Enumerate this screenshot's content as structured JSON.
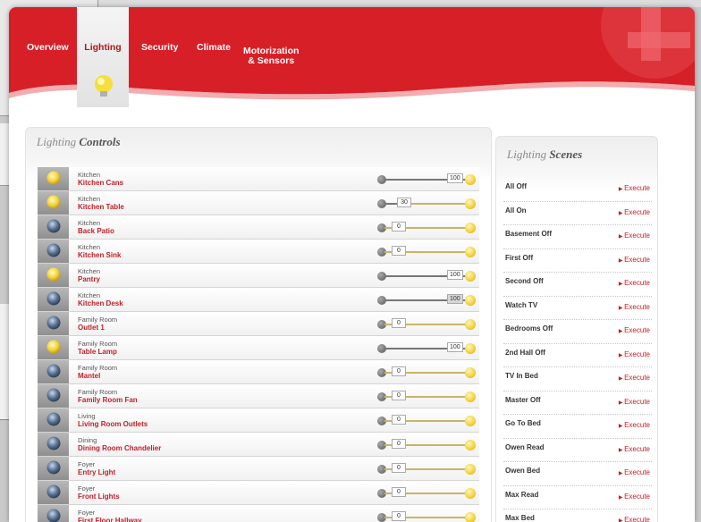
{
  "tabs": [
    {
      "label": "Overview"
    },
    {
      "label": "Lighting"
    },
    {
      "label": "Security"
    },
    {
      "label": "Climate"
    },
    {
      "label": "Motorization\n& Sensors"
    }
  ],
  "controls": {
    "title_a": "Lighting",
    "title_b": "Controls",
    "rows": [
      {
        "room": "Kitchen",
        "name": "Kitchen Cans",
        "value": "100",
        "level": 100,
        "on": true
      },
      {
        "room": "Kitchen",
        "name": "Kitchen Table",
        "value": "30",
        "level": 30,
        "on": true
      },
      {
        "room": "Kitchen",
        "name": "Back Patio",
        "value": "0",
        "level": 0,
        "on": false
      },
      {
        "room": "Kitchen",
        "name": "Kitchen Sink",
        "value": "0",
        "level": 0,
        "on": false
      },
      {
        "room": "Kitchen",
        "name": "Pantry",
        "value": "100",
        "level": 100,
        "on": true
      },
      {
        "room": "Kitchen",
        "name": "Kitchen Desk",
        "value": "100",
        "level": 100,
        "on": false
      },
      {
        "room": "Family Room",
        "name": "Outlet 1",
        "value": "0",
        "level": 0,
        "on": false
      },
      {
        "room": "Family Room",
        "name": "Table Lamp",
        "value": "100",
        "level": 100,
        "on": true
      },
      {
        "room": "Family Room",
        "name": "Mantel",
        "value": "0",
        "level": 0,
        "on": false
      },
      {
        "room": "Family Room",
        "name": "Family Room Fan",
        "value": "0",
        "level": 0,
        "on": false
      },
      {
        "room": "Living",
        "name": "Living Room Outlets",
        "value": "0",
        "level": 0,
        "on": false
      },
      {
        "room": "Dining",
        "name": "Dining Room Chandelier",
        "value": "0",
        "level": 0,
        "on": false
      },
      {
        "room": "Foyer",
        "name": "Entry Light",
        "value": "0",
        "level": 0,
        "on": false
      },
      {
        "room": "Foyer",
        "name": "Front Lights",
        "value": "0",
        "level": 0,
        "on": false
      },
      {
        "room": "Foyer",
        "name": "First Floor Hallway",
        "value": "0",
        "level": 0,
        "on": false
      }
    ]
  },
  "scenes": {
    "title_a": "Lighting",
    "title_b": "Scenes",
    "execute_label": "Execute",
    "items": [
      {
        "name": "All Off"
      },
      {
        "name": "All On"
      },
      {
        "name": "Basement Off"
      },
      {
        "name": "First Off"
      },
      {
        "name": "Second Off"
      },
      {
        "name": "Watch TV"
      },
      {
        "name": "Bedrooms Off"
      },
      {
        "name": "2nd Hall Off"
      },
      {
        "name": "TV In Bed"
      },
      {
        "name": "Master Off"
      },
      {
        "name": "Go To Bed"
      },
      {
        "name": "Owen Read"
      },
      {
        "name": "Owen Bed"
      },
      {
        "name": "Max Read"
      },
      {
        "name": "Max Bed"
      }
    ]
  },
  "colors": {
    "brand_red": "#d71f27",
    "accent_red": "#c0202a",
    "bulb_yellow": "#f2cf3a"
  }
}
